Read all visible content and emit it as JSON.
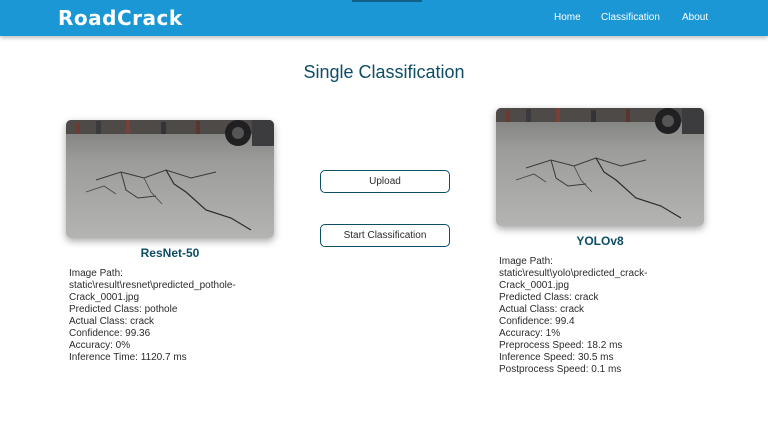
{
  "nav": {
    "brand": "RoadCrack",
    "links": [
      "Home",
      "Classification",
      "About"
    ]
  },
  "page": {
    "title": "Single Classification"
  },
  "buttons": {
    "upload": "Upload",
    "start": "Start Classification"
  },
  "resnet": {
    "title": "ResNet-50",
    "lines": [
      "Image Path:",
      "static\\result\\resnet\\predicted_pothole-",
      "Crack_0001.jpg",
      "Predicted Class: pothole",
      "Actual Class: crack",
      "Confidence: 99.36",
      "Accuracy: 0%",
      "Inference Time: 1120.7 ms"
    ]
  },
  "yolo": {
    "title": "YOLOv8",
    "lines": [
      "Image Path:",
      "static\\result\\yolo\\predicted_crack-",
      "Crack_0001.jpg",
      "Predicted Class: crack",
      "Actual Class: crack",
      "Confidence: 99.4",
      "Accuracy: 1%",
      "Preprocess Speed: 18.2 ms",
      "Inference Speed: 30.5 ms",
      "Postprocess Speed: 0.1 ms"
    ]
  },
  "colors": {
    "navbar": "#1b97d6",
    "heading": "#0d4d66"
  }
}
